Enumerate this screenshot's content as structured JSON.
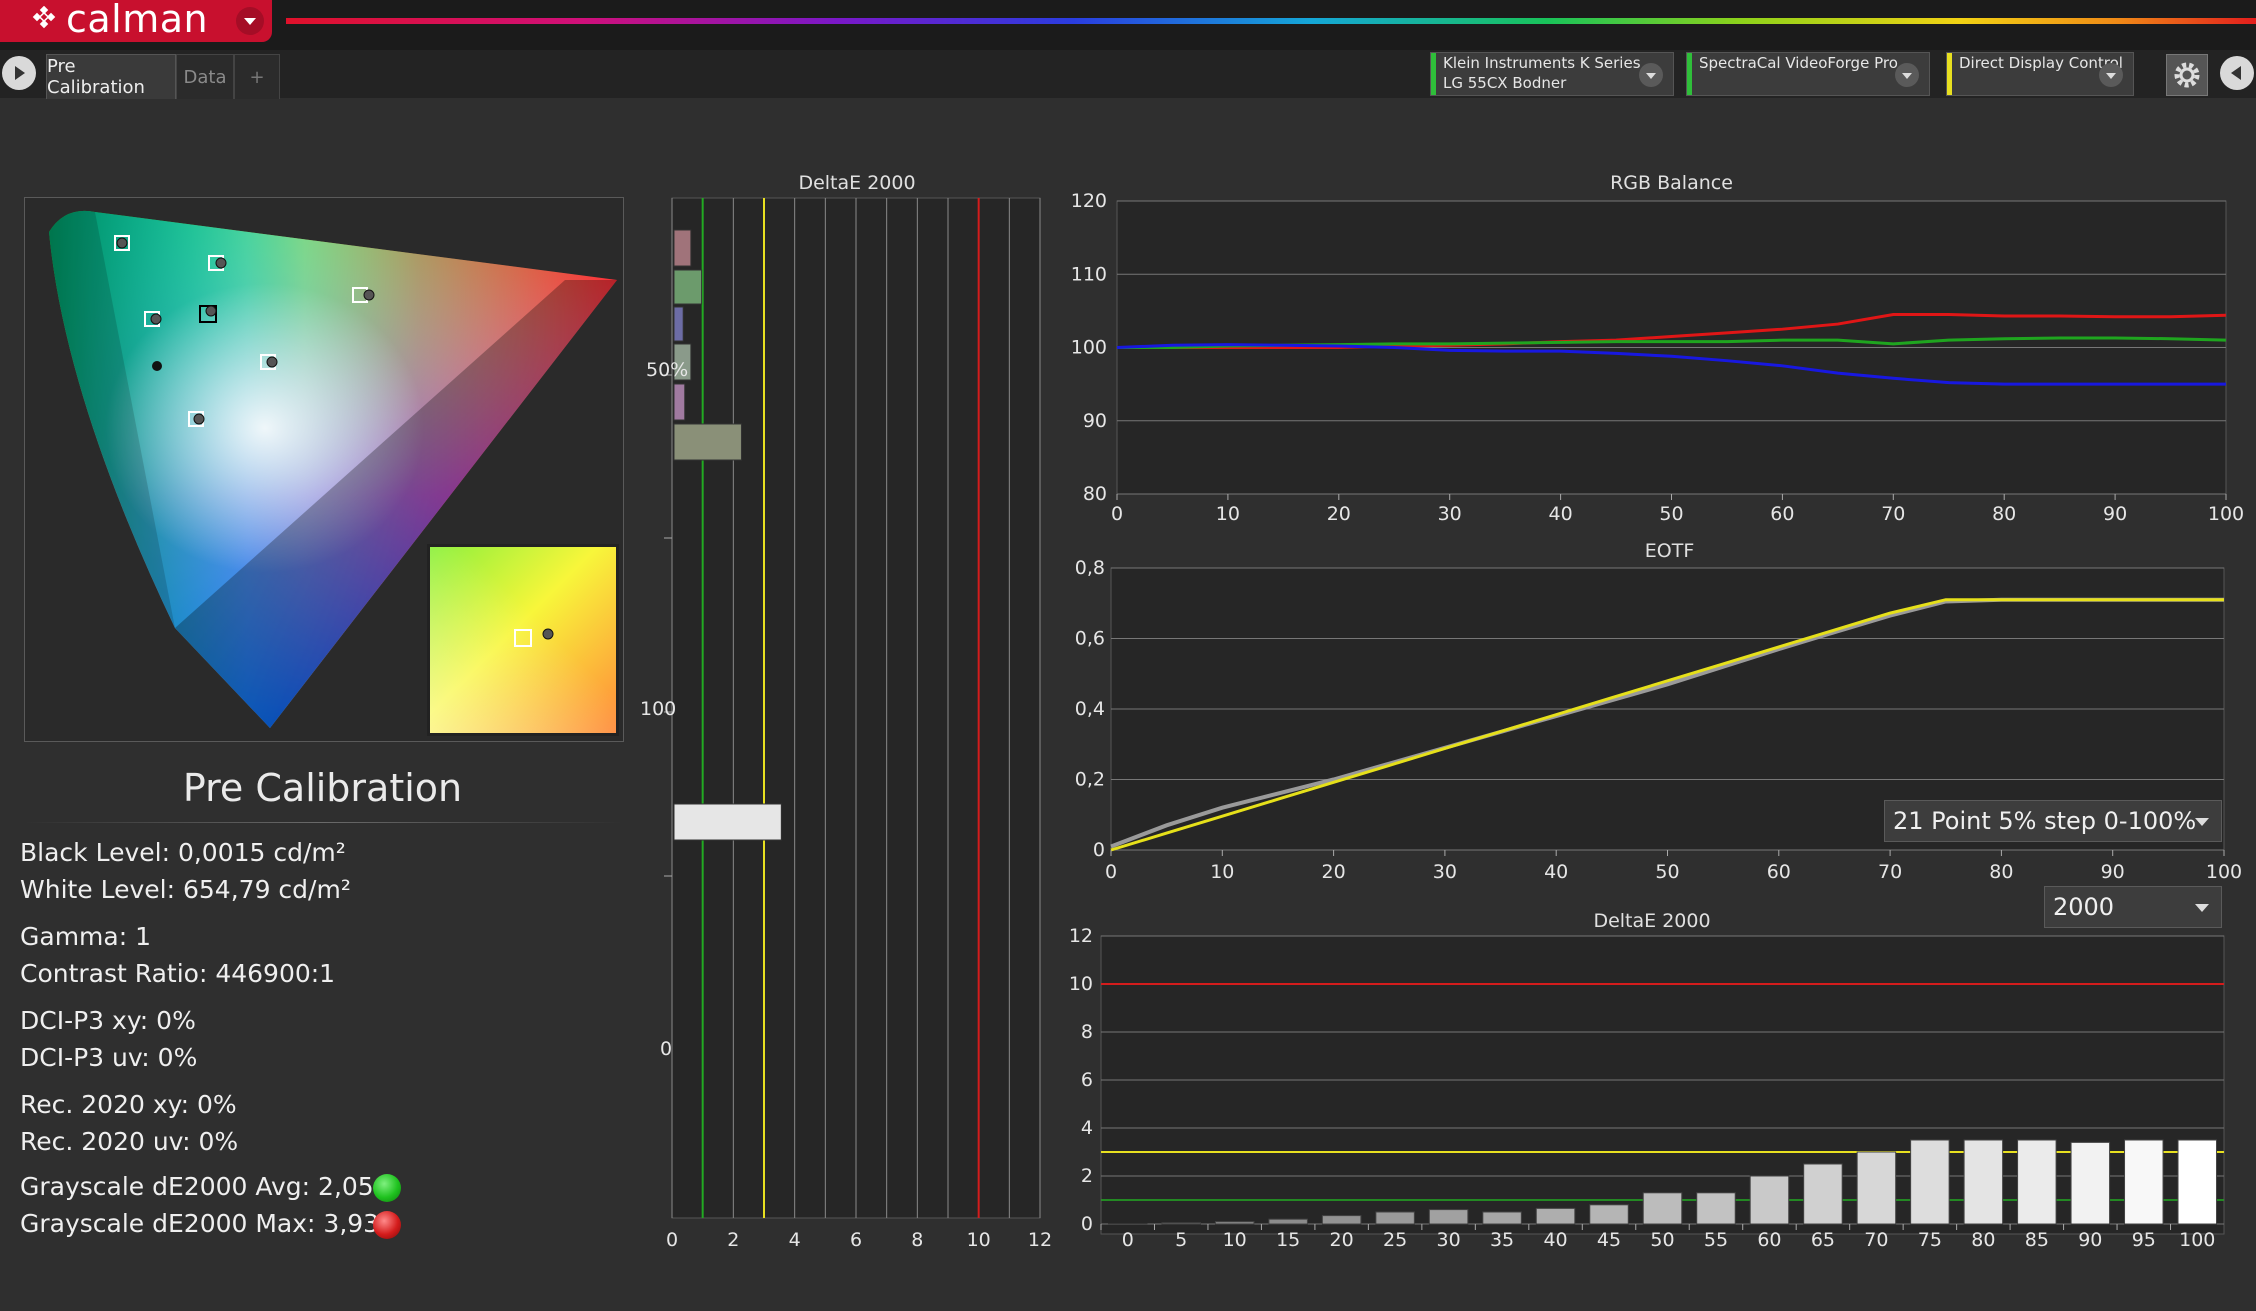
{
  "app": {
    "logo_text": "calman"
  },
  "tabs": [
    {
      "label": "Pre Calibration"
    },
    {
      "label": "Data"
    },
    {
      "label": "+"
    }
  ],
  "devices": [
    {
      "line1": "Klein Instruments K Series",
      "line2": "LG 55CX Bodner",
      "color": "#2fbf3a"
    },
    {
      "line1": "SpectraCal VideoForge Pro",
      "line2": "",
      "color": "#2fbf3a"
    },
    {
      "line1": "Direct Display Control",
      "line2": "",
      "color": "#e8e020"
    }
  ],
  "summary": {
    "title": "Pre Calibration",
    "black_level": "Black Level: 0,0015 cd/m²",
    "white_level": "White Level: 654,79 cd/m²",
    "gamma": "Gamma: 1",
    "contrast": "Contrast Ratio: 446900:1",
    "dci_xy": "DCI-P3 xy: 0%",
    "dci_uv": "DCI-P3 uv: 0%",
    "rec_xy": "Rec. 2020 xy: 0%",
    "rec_uv": "Rec. 2020 uv: 0%",
    "gs_avg": "Grayscale dE2000 Avg: 2,05",
    "gs_max": "Grayscale dE2000 Max: 3,93",
    "avg_color": "#1fc21f",
    "max_color": "#d41c1c"
  },
  "delta_v": {
    "title": "DeltaE 2000",
    "x_ticks": [
      "0",
      "2",
      "4",
      "6",
      "8",
      "10",
      "12"
    ],
    "y_labels": [
      "50%",
      "100",
      "0"
    ],
    "green_line": 1,
    "yellow_line": 3,
    "red_line": 10
  },
  "rgb_balance": {
    "title": "RGB Balance",
    "y_ticks": [
      "120",
      "110",
      "100",
      "90",
      "80"
    ],
    "x_ticks": [
      "0",
      "10",
      "20",
      "30",
      "40",
      "50",
      "60",
      "70",
      "80",
      "90",
      "100"
    ],
    "ylim": [
      80,
      120
    ],
    "x": [
      0,
      5,
      10,
      15,
      20,
      25,
      30,
      35,
      40,
      45,
      50,
      55,
      60,
      65,
      70,
      75,
      80,
      85,
      90,
      95,
      100
    ],
    "series": [
      {
        "color": "#e01616",
        "values": [
          100,
          100,
          100,
          100,
          100,
          100.2,
          100.3,
          100.5,
          100.8,
          101,
          101.5,
          102,
          102.5,
          103.2,
          104.5,
          104.5,
          104.3,
          104.3,
          104.2,
          104.2,
          104.4
        ]
      },
      {
        "color": "#1fa51f",
        "values": [
          100,
          100,
          100.2,
          100.3,
          100.4,
          100.5,
          100.5,
          100.6,
          100.7,
          100.8,
          100.8,
          100.8,
          101,
          101,
          100.5,
          101,
          101.2,
          101.3,
          101.3,
          101.2,
          101
        ]
      },
      {
        "color": "#1818e0",
        "values": [
          100,
          100.3,
          100.4,
          100.3,
          100.2,
          100,
          99.6,
          99.5,
          99.5,
          99.2,
          98.8,
          98.2,
          97.5,
          96.5,
          95.8,
          95.2,
          95,
          95,
          95,
          95,
          95
        ]
      }
    ]
  },
  "eotf": {
    "title": "EOTF",
    "y_ticks": [
      "0,8",
      "0,6",
      "0,4",
      "0,2",
      "0"
    ],
    "x_ticks": [
      "0",
      "10",
      "20",
      "30",
      "40",
      "50",
      "60",
      "70",
      "80",
      "90",
      "100"
    ],
    "ylim": [
      0,
      0.8
    ],
    "x": [
      0,
      5,
      10,
      15,
      20,
      25,
      30,
      35,
      40,
      45,
      50,
      55,
      60,
      65,
      70,
      75,
      80,
      85,
      90,
      95,
      100
    ],
    "target": [
      0.0,
      0.048,
      0.096,
      0.144,
      0.192,
      0.24,
      0.288,
      0.336,
      0.384,
      0.432,
      0.48,
      0.528,
      0.576,
      0.624,
      0.672,
      0.71,
      0.71,
      0.71,
      0.71,
      0.71,
      0.71
    ],
    "measured": [
      0.01,
      0.07,
      0.12,
      0.16,
      0.2,
      0.245,
      0.29,
      0.335,
      0.38,
      0.425,
      0.47,
      0.52,
      0.57,
      0.618,
      0.665,
      0.705,
      0.71,
      0.71,
      0.71,
      0.71,
      0.71
    ],
    "target_color": "#e6e01a",
    "measured_color": "#9a9a9a",
    "select_label": "21 Point 5% step 0-100%"
  },
  "delta_bottom": {
    "title": "DeltaE 2000",
    "select_label": "2000",
    "y_ticks": [
      "12",
      "10",
      "8",
      "6",
      "4",
      "2",
      "0"
    ],
    "ylim": [
      0,
      12
    ],
    "categories": [
      "0",
      "5",
      "10",
      "15",
      "20",
      "25",
      "30",
      "35",
      "40",
      "45",
      "50",
      "55",
      "60",
      "65",
      "70",
      "75",
      "80",
      "85",
      "90",
      "95",
      "100"
    ],
    "values": [
      0,
      0.05,
      0.1,
      0.2,
      0.35,
      0.5,
      0.6,
      0.5,
      0.65,
      0.8,
      1.3,
      1.3,
      2.0,
      2.5,
      3.0,
      3.5,
      3.5,
      3.5,
      3.4,
      3.5,
      3.5
    ],
    "red_line": 10,
    "yellow_line": 3,
    "green_line": 1
  }
}
